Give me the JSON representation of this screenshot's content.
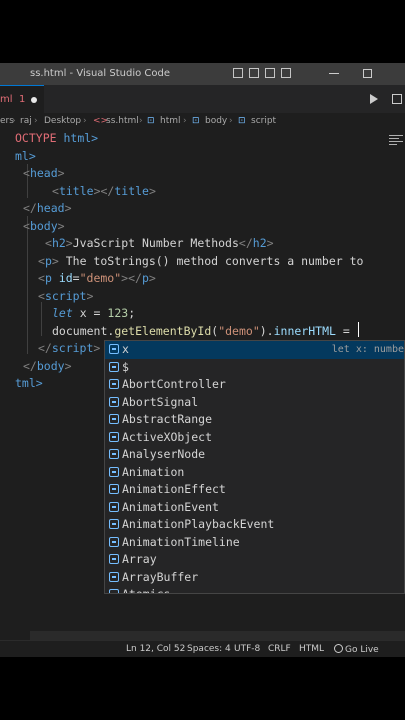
{
  "titlebar": {
    "title": "ss.html - Visual Studio Code",
    "icons": [
      "layout-sidebar-icon",
      "layout-panel-icon",
      "layout-secondary-sidebar-icon",
      "customize-layout-icon"
    ]
  },
  "tab": {
    "name": "ml",
    "problems": "1"
  },
  "breadcrumb": [
    "ers",
    "raj",
    "Desktop",
    "ss.html",
    "html",
    "body",
    "script"
  ],
  "code": {
    "l1": [
      "OCTYPE",
      " html>"
    ],
    "l2": "ml>",
    "l3": "head",
    "l4": [
      "title",
      "</",
      "title"
    ],
    "l5": "head",
    "l6": "body",
    "l7": [
      "h2",
      "JvaScript Number Methods",
      "h2"
    ],
    "l8": [
      "p",
      "The toStrings() method converts a number to"
    ],
    "l9": [
      "p",
      "id",
      "\"demo\"",
      "p"
    ],
    "l10": "script",
    "l11": [
      "let",
      " x = ",
      "123",
      ";"
    ],
    "l12": [
      "document",
      ".",
      "getElementById",
      "(",
      "\"demo\"",
      ").",
      "innerHTML",
      " ="
    ],
    "l13": "script",
    "l14": "body",
    "l15": "tml>"
  },
  "autocomplete": {
    "items": [
      {
        "label": "x",
        "detail": "let x: numbe"
      },
      {
        "label": "$",
        "detail": ""
      },
      {
        "label": "AbortController",
        "detail": ""
      },
      {
        "label": "AbortSignal",
        "detail": ""
      },
      {
        "label": "AbstractRange",
        "detail": ""
      },
      {
        "label": "ActiveXObject",
        "detail": ""
      },
      {
        "label": "AnalyserNode",
        "detail": ""
      },
      {
        "label": "Animation",
        "detail": ""
      },
      {
        "label": "AnimationEffect",
        "detail": ""
      },
      {
        "label": "AnimationEvent",
        "detail": ""
      },
      {
        "label": "AnimationPlaybackEvent",
        "detail": ""
      },
      {
        "label": "AnimationTimeline",
        "detail": ""
      },
      {
        "label": "Array",
        "detail": ""
      },
      {
        "label": "ArrayBuffer",
        "detail": ""
      },
      {
        "label": "Atomics",
        "detail": ""
      }
    ]
  },
  "status": {
    "position": "Ln 12, Col 52",
    "spaces": "Spaces: 4",
    "encoding": "UTF-8",
    "eol": "CRLF",
    "language": "HTML",
    "golive": "Go Live"
  }
}
